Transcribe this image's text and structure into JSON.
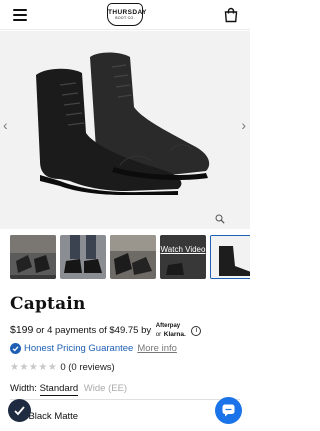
{
  "header": {
    "menu_icon": "hamburger-menu-icon",
    "logo_line1": "THURSDAY",
    "logo_line2": "BOOT CO.",
    "cart_icon": "shopping-bag-icon"
  },
  "gallery": {
    "prev_icon": "chevron-left-icon",
    "next_icon": "chevron-right-icon",
    "prev_glyph": "‹",
    "next_glyph": "›",
    "zoom_icon": "magnifier-icon",
    "video_label": "Watch Video"
  },
  "product": {
    "name": "Captain",
    "price": "$199",
    "installments": "or 4 payments of $49.75 by",
    "afterpay": "Afterpay",
    "or_text": "or",
    "klarna": "Klarna.",
    "info_glyph": "i",
    "guarantee": "Honest Pricing Guarantee",
    "more_info": "More info",
    "stars": "★★★★★",
    "rating": "0",
    "reviews": "(0 reviews)",
    "width_label": "Width:",
    "width_selected": "Standard",
    "width_other": "Wide (EE)",
    "color_prefix": "r:",
    "color_value": "Black Matte"
  },
  "colors": {
    "accent": "#1e5fb4",
    "chat_button": "#1a73e8",
    "badge_bg": "#1f2b40"
  }
}
